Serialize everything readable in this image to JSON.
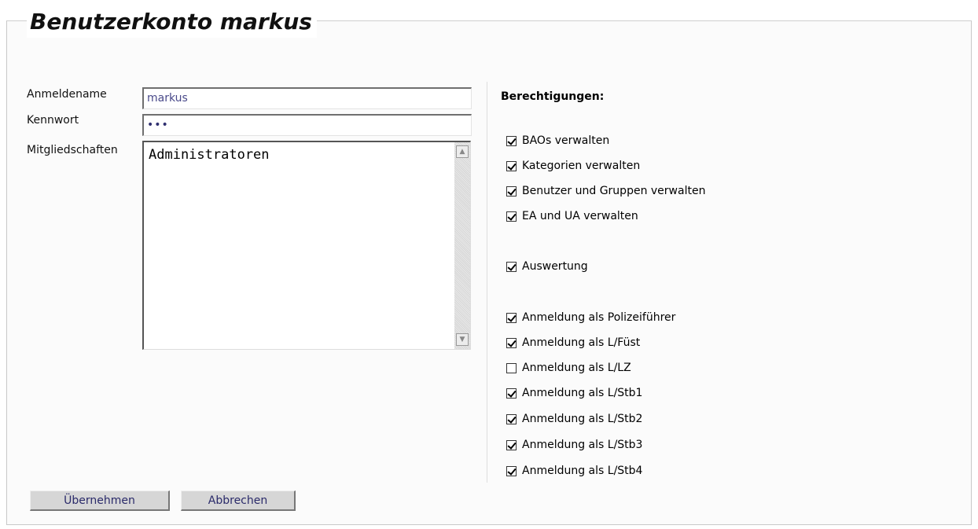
{
  "header": {
    "title": "Benutzerkonto markus"
  },
  "form": {
    "username_label": "Anmeldename",
    "username_value": "markus",
    "password_label": "Kennwort",
    "password_value": "•••",
    "memberships_label": "Mitgliedschaften",
    "memberships": [
      "Administratoren"
    ]
  },
  "permissions": {
    "title": "Berechtigungen:",
    "items": [
      {
        "label": "BAOs verwalten",
        "checked": true
      },
      {
        "label": "Kategorien verwalten",
        "checked": true
      },
      {
        "label": "Benutzer und Gruppen verwalten",
        "checked": true
      },
      {
        "label": "EA und UA verwalten",
        "checked": true
      },
      {
        "label": "Auswertung",
        "checked": true
      },
      {
        "label": "Anmeldung als Polizeiführer",
        "checked": true
      },
      {
        "label": "Anmeldung als L/Füst",
        "checked": true
      },
      {
        "label": "Anmeldung als L/LZ",
        "checked": false
      },
      {
        "label": "Anmeldung als L/Stb1",
        "checked": true
      },
      {
        "label": "Anmeldung als L/Stb2",
        "checked": true
      },
      {
        "label": "Anmeldung als L/Stb3",
        "checked": true
      },
      {
        "label": "Anmeldung als L/Stb4",
        "checked": true
      }
    ]
  },
  "buttons": {
    "apply_label": "Übernehmen",
    "cancel_label": "Abbrechen"
  },
  "icons": {
    "scroll_up": "scroll-up-arrow-icon",
    "scroll_down": "scroll-down-arrow-icon"
  }
}
